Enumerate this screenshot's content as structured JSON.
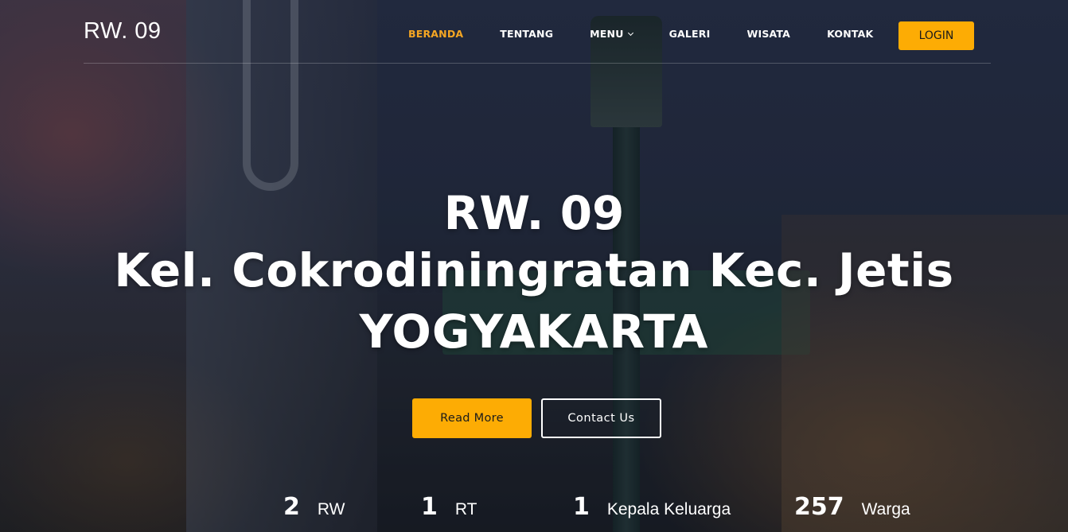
{
  "header": {
    "logo": "RW. 09",
    "nav": [
      {
        "label": "BERANDA",
        "active": true
      },
      {
        "label": "TENTANG",
        "active": false
      },
      {
        "label": "MENU",
        "active": false,
        "dropdown": true
      },
      {
        "label": "GALERI",
        "active": false
      },
      {
        "label": "WISATA",
        "active": false
      },
      {
        "label": "KONTAK",
        "active": false
      }
    ],
    "login_label": "LOGIN"
  },
  "hero": {
    "line1": "RW. 09",
    "line2": "Kel. Cokrodiningratan Kec. Jetis",
    "line3": "YOGYAKARTA",
    "read_more": "Read More",
    "contact_us": "Contact Us"
  },
  "stats": [
    {
      "value": "2",
      "label": "RW"
    },
    {
      "value": "1",
      "label": "RT"
    },
    {
      "value": "1",
      "label": "Kepala Keluarga"
    },
    {
      "value": "257",
      "label": "Warga"
    }
  ],
  "colors": {
    "accent": "#fdac04",
    "active_nav": "#f5a623",
    "text": "#ffffff"
  },
  "icons": {
    "menu_dropdown": "chevron-down-icon"
  }
}
